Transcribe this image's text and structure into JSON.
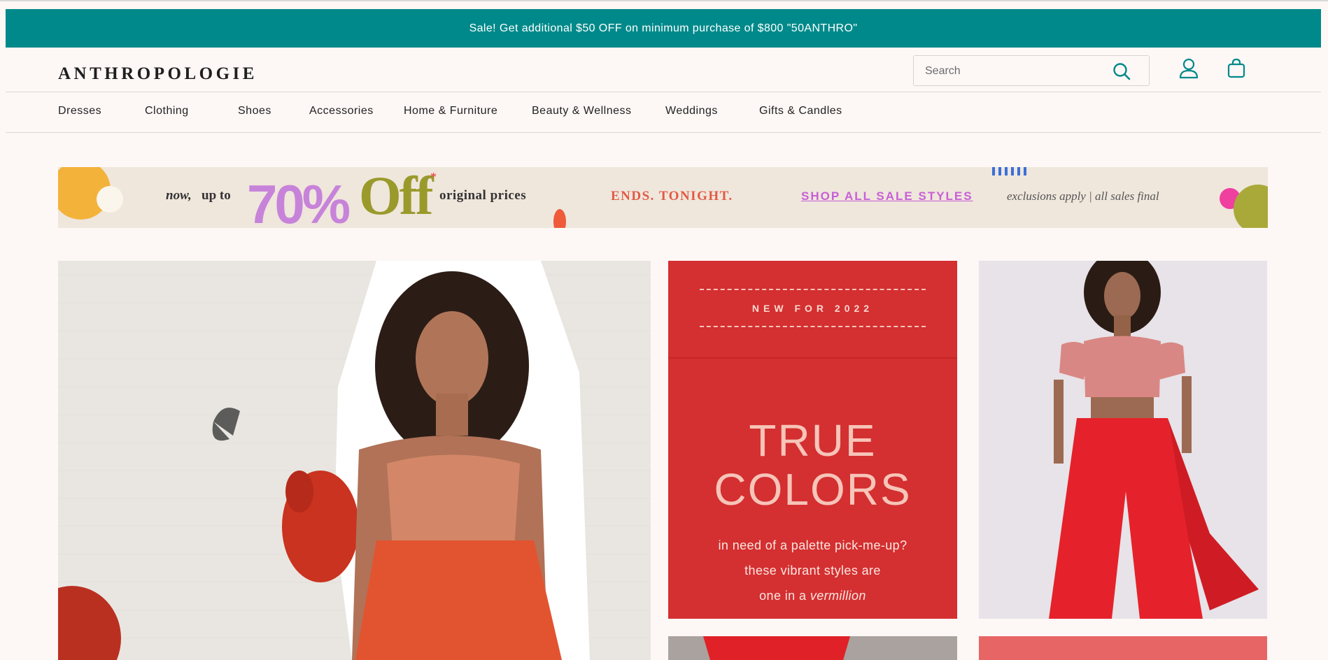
{
  "promo": {
    "text": "Sale! Get additional $50 OFF on minimum purchase of $800 \"50ANTHRO\""
  },
  "brand": {
    "logo": "ANTHROPOLOGIE"
  },
  "search": {
    "placeholder": "Search"
  },
  "icons": {
    "search": "search-icon",
    "account": "user-icon",
    "bag": "shopping-bag-icon"
  },
  "nav": {
    "items": [
      {
        "label": "Dresses"
      },
      {
        "label": "Clothing"
      },
      {
        "label": "Shoes"
      },
      {
        "label": "Accessories"
      },
      {
        "label": "Home & Furniture"
      },
      {
        "label": "Beauty & Wellness"
      },
      {
        "label": "Weddings"
      },
      {
        "label": "Gifts & Candles"
      }
    ]
  },
  "sale_banner": {
    "now": "now,",
    "up_to": "up to",
    "percent": "70%",
    "off": "Off",
    "asterisk": "*",
    "original": "original prices",
    "ends": "ENDS. TONIGHT.",
    "cta": "SHOP ALL SALE STYLES",
    "exclusions": "exclusions apply | all sales final"
  },
  "promo_tile": {
    "eyebrow": "NEW FOR 2022",
    "title_line1": "TRUE",
    "title_line2": "COLORS",
    "sub_line1": "in need of a palette pick-me-up?",
    "sub_line2": "these vibrant styles are",
    "sub_line3_a": "one in a",
    "sub_line3_b": "vermillion"
  },
  "colors": {
    "promo_bar": "#00898a",
    "accent_teal": "#00898a",
    "background": "#fdf7f6",
    "tile_red": "#d42f31"
  }
}
